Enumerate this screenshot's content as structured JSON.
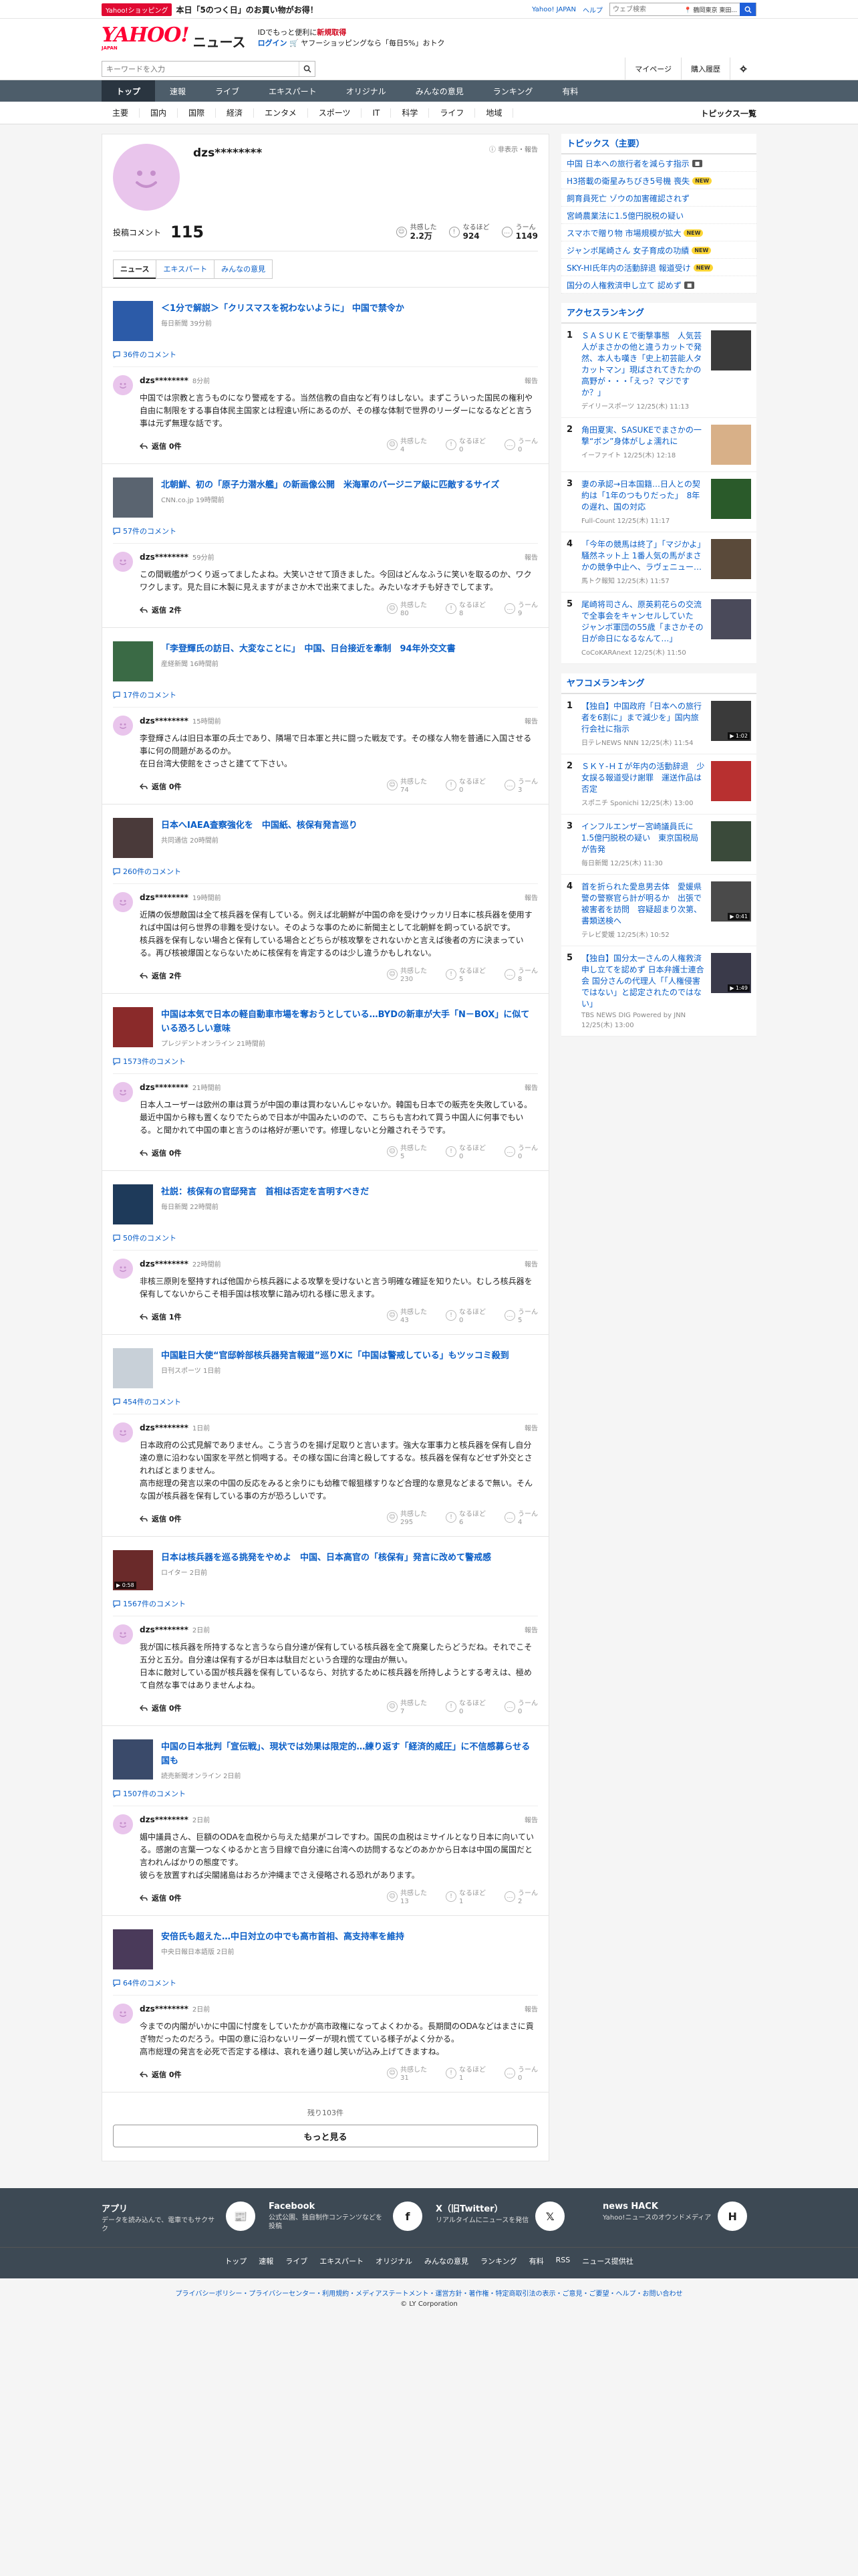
{
  "promo": {
    "chip": "Yahoo!ショッピング",
    "text": "本日「5のつく日」のお買い物がお得！",
    "yahoo_japan": "Yahoo! JAPAN",
    "help": "ヘルプ",
    "web_search_placeholder": "ウェブ検索",
    "location": "📍 鶴岡東京 東田..."
  },
  "header": {
    "logo_main": "YAHOO!",
    "logo_sub": "JAPAN",
    "logo_news": "ニュース",
    "msg_line1_pre": "IDでもっと便利に",
    "msg_line1_red": "新規取得",
    "msg_line2_login": "ログイン",
    "msg_line2_rest": "🛒 ヤフーショッピングなら「毎日5%」おトク"
  },
  "search": {
    "placeholder": "キーワードを入力",
    "mypage": "マイページ",
    "history": "購入履歴"
  },
  "nav1": [
    "トップ",
    "速報",
    "ライブ",
    "エキスパート",
    "オリジナル",
    "みんなの意見",
    "ランキング",
    "有料"
  ],
  "nav2": {
    "cats": [
      "主要",
      "国内",
      "国際",
      "経済",
      "エンタメ",
      "スポーツ",
      "IT",
      "科学",
      "ライフ",
      "地域"
    ],
    "all": "トピックス一覧"
  },
  "profile": {
    "name": "dzs********",
    "report_link": "ⓘ 非表示・報告",
    "comments_label": "投稿コメント",
    "comments_count": "115",
    "reacts": [
      {
        "icon": "☺",
        "label": "共感した",
        "value": "2.2万"
      },
      {
        "icon": "!",
        "label": "なるほど",
        "value": "924"
      },
      {
        "icon": "…",
        "label": "うーん",
        "value": "1149"
      }
    ],
    "tabs": [
      "ニュース",
      "エキスパート",
      "みんなの意見"
    ]
  },
  "labels": {
    "report": "報告",
    "empathy": "共感した",
    "indeed": "なるほど",
    "hmm": "うーん"
  },
  "entries": [
    {
      "title": "＜1分で解説＞「クリスマスを祝わないように」 中国で禁令か",
      "meta": "毎日新聞 39分前",
      "ccount": "36件のコメント",
      "thumb": "#2c5ba8",
      "play": "",
      "time": "8分前",
      "text": "中国では宗教と言うものになり警戒をする。当然信教の自由など有りはしない。まずこういった国民の権利や自由に制限をする事自体民主国家とは程遠い所にあるのが、その様な体制で世界のリーダーになるなどと言う事は元ず無理な話です。",
      "reply": "返信 0件",
      "r": [
        "4",
        "0",
        "0"
      ]
    },
    {
      "title": "北朝鮮、初の「原子力潜水艦」の新画像公開　米海軍のバージニア級に匹敵するサイズ",
      "meta": "CNN.co.jp 19時間前",
      "ccount": "57件のコメント",
      "thumb": "#5a6470",
      "play": "",
      "time": "59分前",
      "text": "この間戦艦がつくり返ってましたよね。大笑いさせて頂きました。今回はどんなふうに笑いを取るのか、ワクワクします。見た目に木製に見えますがまさか木で出来てました。みたいなオチも好きでしてます。",
      "reply": "返信 2件",
      "r": [
        "80",
        "8",
        "9"
      ]
    },
    {
      "title": "「李登輝氏の訪日、大変なことに」　中国、日台接近を牽制　94年外交文書",
      "meta": "産経新聞 16時間前",
      "ccount": "17件のコメント",
      "thumb": "#3a6a45",
      "play": "",
      "time": "15時間前",
      "text": "李登輝さんは旧日本軍の兵士であり、隣場で日本軍と共に闘った戦友です。その様な人物を普通に入国させる事に何の問題があるのか。\n在日台湾大使館をさっさと建てて下さい。",
      "reply": "返信 0件",
      "r": [
        "74",
        "0",
        "3"
      ]
    },
    {
      "title": "日本へIAEA査察強化を　中国紙、核保有発言巡り",
      "meta": "共同通信 20時間前",
      "ccount": "260件のコメント",
      "thumb": "#4a3a3a",
      "play": "",
      "time": "19時間前",
      "text": "近隣の仮想敵国は全て核兵器を保有している。例えば北朝鮮が中国の命を受けウッカリ日本に核兵器を使用すれば中国は何ら世界の非難を受けない。そのような事のために新聞主として北朝鮮を飼っている訳です。\n核兵器を保有しない場合と保有している場合とどちらが核攻撃をされないかと言えば後者の方に決まっている。再び核被爆国とならないために核保有を肯定するのは少し違うかもしれない。",
      "reply": "返信 2件",
      "r": [
        "230",
        "5",
        "8"
      ]
    },
    {
      "title": "中国は本気で日本の軽自動車市場を奪おうとしている…BYDの新車が大手「N－BOX」に似ている恐ろしい意味",
      "meta": "プレジデントオンライン 21時間前",
      "ccount": "1573件のコメント",
      "thumb": "#8a2a2a",
      "play": "",
      "time": "21時間前",
      "text": "日本人ユーザーは欧州の車は買うが中国の車は買わないんじゃないか。韓国も日本での販売を失敗している。最近中国から稼も置くなりでたらめで日本が中国みたいのので、こちらも言われて買う中国人に何事でもいる。と聞かれて中国の車と言うのは格好が悪いです。修理しないと分離されそうです。",
      "reply": "返信 0件",
      "r": [
        "5",
        "0",
        "0"
      ]
    },
    {
      "title": "社説：核保有の官邸発言　首相は否定を言明すべきだ",
      "meta": "毎日新聞 22時間前",
      "ccount": "50件のコメント",
      "thumb": "#1e3a5a",
      "play": "",
      "time": "22時間前",
      "text": "非核三原則を堅持すれば他国から核兵器による攻撃を受けないと言う明確な確証を知りたい。むしろ核兵器を保有してないからこそ相手国は核攻撃に踏み切れる様に思えます。",
      "reply": "返信 1件",
      "r": [
        "43",
        "0",
        "5"
      ]
    },
    {
      "title": "中国駐日大使“官邸幹部核兵器発言報道”巡りXに「中国は警戒している」もツッコミ殺到",
      "meta": "日刊スポーツ 1日前",
      "ccount": "454件のコメント",
      "thumb": "#c8d0d8",
      "play": "",
      "time": "1日前",
      "text": "日本政府の公式見解でありません。こう言うのを揚げ足取りと言います。強大な軍事力と核兵器を保有し自分達の意に沿わない国家を平然と恫喝する。その様な国に台湾と殺してするな。核兵器を保有などせず外交とされればとまりません。\n高市総理の発言以来の中国の反応をみると余りにも幼稚で報狙様すりなど合理的な意見などまるで無い。そんな国が核兵器を保有している事の方が恐ろしいです。",
      "reply": "返信 0件",
      "r": [
        "295",
        "6",
        "4"
      ]
    },
    {
      "title": "日本は核兵器を巡る挑発をやめよ　中国、日本高官の「核保有」発言に改めて警戒感",
      "meta": "ロイター 2日前",
      "ccount": "1567件のコメント",
      "thumb": "#6a2a2a",
      "play": "▶ 0:58",
      "time": "2日前",
      "text": "我が国に核兵器を所持するなと言うなら自分達が保有している核兵器を全て廃棄したらどうだね。それでこそ五分と五分。自分達は保有するが日本は駄目だという合理的な理由が無い。\n日本に敵対している国が核兵器を保有しているなら、対抗するために核兵器を所持しようとする考えは、極めて自然な事ではありませんよね。",
      "reply": "返信 0件",
      "r": [
        "7",
        "0",
        "0"
      ]
    },
    {
      "title": "中国の日本批判「宣伝戦」、現状では効果は限定的…練り返す「経済的威圧」に不信感募らせる国も",
      "meta": "読売新聞オンライン 2日前",
      "ccount": "1507件のコメント",
      "thumb": "#3a4a6a",
      "play": "",
      "time": "2日前",
      "text": "媚中議員さん、巨額のODAを血税から与えた結果がコレですわ。国民の血税はミサイルとなり日本に向いている。感謝の言葉一つなくゆるかと言う目線で自分達に台湾への訪問するなどのあかから日本は中国の属国だと言われんばかりの態度です。\n彼らを放置すれば尖閣諸島はおろか沖縄までさえ侵略される恐れがあります。",
      "reply": "返信 0件",
      "r": [
        "13",
        "1",
        "2"
      ]
    },
    {
      "title": "安倍氏も超えた…中日対立の中でも高市首相、高支持率を維持",
      "meta": "中央日報日本語版 2日前",
      "ccount": "64件のコメント",
      "thumb": "#4a3a5a",
      "play": "",
      "time": "2日前",
      "text": "今までの内閣がいかに中国に忖度をしていたかが高市政権になってよくわかる。長期間のODAなどはまさに貢ぎ物だったのだろう。中国の意に沿わないリーダーが現れ慌てている様子がよく分かる。\n高市総理の発言を必死で否定する様は、哀れを通り越し笑いが込み上げてきますね。",
      "reply": "返信 0件",
      "r": [
        "31",
        "1",
        "0"
      ]
    }
  ],
  "more": {
    "remain": "残り103件",
    "button": "もっと見る"
  },
  "sidebar": {
    "topics_head": "トピックス（主要）",
    "topics": [
      {
        "text": "中国 日本への旅行者を減らす指示",
        "badge": "cam"
      },
      {
        "text": "H3搭載の衛星みちびき5号機 喪失",
        "badge": "new"
      },
      {
        "text": "飼育員死亡 ゾウの加害確認されず",
        "badge": ""
      },
      {
        "text": "宮崎農業法に1.5億円脱税の疑い",
        "badge": ""
      },
      {
        "text": "スマホで贈り物 市場規模が拡大",
        "badge": "new"
      },
      {
        "text": "ジャンボ尾崎さん 女子育成の功績",
        "badge": "new"
      },
      {
        "text": "SKY-HI氏年内の活動辞退 報道受け",
        "badge": "new"
      },
      {
        "text": "国分の人権救済申し立て 認めず",
        "badge": "cam"
      }
    ],
    "access_head": "アクセスランキング",
    "access": [
      {
        "title": "ＳＡＳＵＫＥで衝撃事態　人気芸人がまさかの他と違うカットで発然、本人も嘆き「史上初芸能人タカットマン」現ばされてきたかの高野が・・・「えっ？マジですか？」",
        "meta": "デイリースポーツ 12/25(木) 11:13",
        "thumb": "#3a3a3a",
        "play": ""
      },
      {
        "title": "角田夏実、SASUKEでまさかの一撃“ボン”身体がしょ濡れに",
        "meta": "イーファイト 12/25(木) 12:18",
        "thumb": "#d8b088",
        "play": ""
      },
      {
        "title": "妻の承認→日本国籍…日人との契約は「1年のつもりだった」　8年の遅れ、国の対応",
        "meta": "Full-Count 12/25(木) 11:17",
        "thumb": "#2a5a2a",
        "play": ""
      },
      {
        "title": "「今年の競馬は終了」「マジかよ」騒然ネット上 1番人気の馬がまさかの競争中止へ、ラヴェニュー…",
        "meta": "馬トク報知 12/25(木) 11:57",
        "thumb": "#5a4a3a",
        "play": ""
      },
      {
        "title": "尾崎将司さん、原英莉花らの交流で全事会をキャンセルしていた　ジャンボ軍団の55歳「まさかその日が命日になるなんて…」",
        "meta": "CoCoKARAnext 12/25(木) 11:50",
        "thumb": "#4a4a5a",
        "play": ""
      }
    ],
    "yahoo_head": "ヤフコメランキング",
    "yahoo": [
      {
        "title": "【独自】中国政府「日本への旅行者を6割に」まで減少を」国内旅行会社に指示",
        "meta": "日テレNEWS NNN 12/25(木) 11:54",
        "thumb": "#3a3a3a",
        "play": "▶ 1:02"
      },
      {
        "title": "ＳＫＹ-ＨＩが年内の活動辞退　少女誤る報道受け謝罪　運送作品は否定",
        "meta": "スポニチ Sponichi 12/25(木) 13:00",
        "thumb": "#b83030",
        "play": ""
      },
      {
        "title": "インフルエンザー宮崎議員氏に1.5億円脱税の疑い　東京国税局が告発",
        "meta": "毎日新聞 12/25(木) 11:30",
        "thumb": "#3a4a3a",
        "play": ""
      },
      {
        "title": "首を折られた愛息男去体　愛媛県警の警察官ら計が明るか　出張で被害者を訪問　容疑超まり次第、書類送検へ",
        "meta": "テレビ愛媛 12/25(木) 10:52",
        "thumb": "#4a4a4a",
        "play": "▶ 0:41"
      },
      {
        "title": "【独自】国分太一さんの人権救済申し立てを認めず 日本弁護士連合会 国分さんの代理人「「人権侵害ではない」と認定されたのではない」",
        "meta": "TBS NEWS DIG Powered by JNN 12/25(木) 13:00",
        "thumb": "#3a3a4a",
        "play": "▶ 1:49"
      }
    ]
  },
  "footer": {
    "apps": [
      {
        "title": "アプリ",
        "desc": "データを読み込んで、電車でもサクサク",
        "icon": "📰"
      },
      {
        "title": "Facebook",
        "desc": "公式公園、独自制作コンテンツなどを投稿",
        "icon": "f"
      },
      {
        "title": "X（旧Twitter）",
        "desc": "リアルタイムにニュースを発信",
        "icon": "𝕏"
      },
      {
        "title": "news HACK",
        "desc": "Yahoo!ニュースのオウンドメディア",
        "icon": "H"
      }
    ],
    "nav": [
      "トップ",
      "速報",
      "ライブ",
      "エキスパート",
      "オリジナル",
      "みんなの意見",
      "ランキング",
      "有料",
      "RSS",
      "ニュース提供社"
    ],
    "legal": "プライバシーポリシー・プライバシーセンター・利用規約・メディアステートメント・運営方針・著作権・特定商取引法の表示・ご意見・ご要望・ヘルプ・お問い合わせ",
    "copyright": "© LY Corporation"
  }
}
